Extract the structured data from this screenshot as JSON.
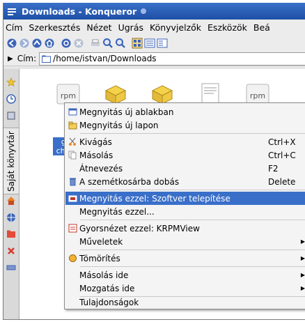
{
  "window": {
    "title": "Downloads - Konqueror"
  },
  "menubar": [
    "Cím",
    "Szerkesztés",
    "Nézet",
    "Ugrás",
    "Könyvjelzők",
    "Eszközök",
    "Beá"
  ],
  "location": {
    "label": "Cím:",
    "value": "/home/istvan/Downloads"
  },
  "sidebar": {
    "vertical_label": "Saját könyvtár"
  },
  "files": {
    "selected_label_line1": "goo",
    "selected_label_line2": "chrom"
  },
  "context_menu": {
    "items": [
      {
        "label": "Megnyitás új ablakban",
        "icon": "window-icon"
      },
      {
        "label": "Megnyitás új lapon",
        "icon": "tab-icon"
      },
      {
        "label": "Kivágás",
        "shortcut": "Ctrl+X",
        "icon": "cut-icon"
      },
      {
        "label": "Másolás",
        "shortcut": "Ctrl+C",
        "icon": "copy-icon"
      },
      {
        "label": "Átnevezés",
        "shortcut": "F2"
      },
      {
        "label": "A szemétkosárba dobás",
        "shortcut": "Delete",
        "icon": "trash-icon"
      },
      {
        "label": "Megnyitás ezzel: Szoftver telepítése",
        "icon": "package-icon",
        "highlighted": true
      },
      {
        "label": "Megnyitás ezzel..."
      },
      {
        "label": "Gyorsnézet ezzel: KRPMView",
        "icon": "view-icon"
      },
      {
        "label": "Műveletek",
        "submenu": true
      },
      {
        "label": "Tömörítés",
        "submenu": true,
        "icon": "compress-icon"
      },
      {
        "label": "Másolás ide",
        "submenu": true
      },
      {
        "label": "Mozgatás ide",
        "submenu": true
      },
      {
        "label": "Tulajdonságok"
      }
    ]
  },
  "colors": {
    "titlebar": "#2d5fb8",
    "highlight": "#3a6fc9"
  }
}
